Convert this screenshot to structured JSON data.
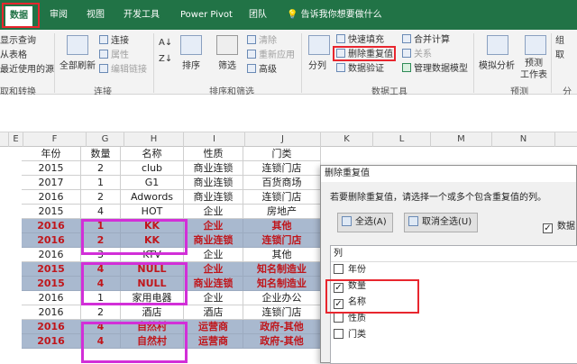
{
  "ribbon_tabs": {
    "active": "数据",
    "items": [
      "审阅",
      "视图",
      "开发工具",
      "Power Pivot",
      "团队"
    ],
    "tell_me": "告诉我你想要做什么"
  },
  "ribbon": {
    "get_external": {
      "items": [
        "显示查询",
        "从表格",
        "最近使用的源"
      ],
      "label": "取和转换"
    },
    "connections": {
      "refresh_all": "全部刷新",
      "connections": "连接",
      "properties": "属性",
      "edit_links": "编辑链接",
      "label": "连接"
    },
    "sort_filter": {
      "sort": "排序",
      "filter": "筛选",
      "clear": "清除",
      "reapply": "重新应用",
      "advanced": "高级",
      "label": "排序和筛选"
    },
    "data_tools": {
      "text_to_columns": "分列",
      "flash_fill": "快速填充",
      "remove_duplicates": "删除重复值",
      "validation": "数据验证",
      "consolidate": "合并计算",
      "relationships": "关系",
      "manage_model": "管理数据模型",
      "label": "数据工具"
    },
    "forecast": {
      "what_if": "模拟分析",
      "forecast_sheet": "预测\n工作表",
      "label": "预测"
    },
    "outline": {
      "group": "组",
      "ungroup": "取",
      "label": "分"
    }
  },
  "column_headers": [
    "E",
    "F",
    "G",
    "H",
    "I",
    "J",
    "K",
    "L",
    "M",
    "N"
  ],
  "table": {
    "headers": [
      "年份",
      "数量",
      "名称",
      "性质",
      "门类"
    ],
    "rows": [
      {
        "cells": [
          "2015",
          "2",
          "club",
          "商业连锁",
          "连锁门店"
        ],
        "dup": false
      },
      {
        "cells": [
          "2017",
          "1",
          "G1",
          "商业连锁",
          "百货商场"
        ],
        "dup": false
      },
      {
        "cells": [
          "2016",
          "2",
          "Adwords",
          "商业连锁",
          "连锁门店"
        ],
        "dup": false
      },
      {
        "cells": [
          "2015",
          "4",
          "HOT",
          "企业",
          "房地产"
        ],
        "dup": false
      },
      {
        "cells": [
          "2016",
          "1",
          "KK",
          "企业",
          "其他"
        ],
        "dup": true
      },
      {
        "cells": [
          "2016",
          "2",
          "KK",
          "商业连锁",
          "连锁门店"
        ],
        "dup": true
      },
      {
        "cells": [
          "2016",
          "3",
          "KTV",
          "企业",
          "其他"
        ],
        "dup": false
      },
      {
        "cells": [
          "2015",
          "4",
          "NULL",
          "企业",
          "知名制造业"
        ],
        "dup": true
      },
      {
        "cells": [
          "2015",
          "4",
          "NULL",
          "商业连锁",
          "知名制造业"
        ],
        "dup": true
      },
      {
        "cells": [
          "2016",
          "1",
          "家用电器",
          "企业",
          "企业办公"
        ],
        "dup": false
      },
      {
        "cells": [
          "2016",
          "2",
          "酒店",
          "酒店",
          "连锁门店"
        ],
        "dup": false
      },
      {
        "cells": [
          "2016",
          "4",
          "自然村",
          "运营商",
          "政府-其他"
        ],
        "dup": true
      },
      {
        "cells": [
          "2016",
          "4",
          "自然村",
          "运营商",
          "政府-其他"
        ],
        "dup": true
      }
    ]
  },
  "dialog": {
    "title": "删除重复值",
    "message": "若要删除重复值，请选择一个或多个包含重复值的列。",
    "select_all": "全选(A)",
    "unselect_all": "取消全选(U)",
    "has_headers": "数据",
    "list_header": "列",
    "columns": [
      {
        "label": "年份",
        "checked": false
      },
      {
        "label": "数量",
        "checked": true
      },
      {
        "label": "名称",
        "checked": true
      },
      {
        "label": "性质",
        "checked": false
      },
      {
        "label": "门类",
        "checked": false
      }
    ]
  },
  "colors": {
    "excel_green": "#217346",
    "dup_fill": "#a9b9cf",
    "dup_text": "#c0161b",
    "highlight_magenta": "#d22fd8",
    "red_outline": "#e8262e"
  }
}
